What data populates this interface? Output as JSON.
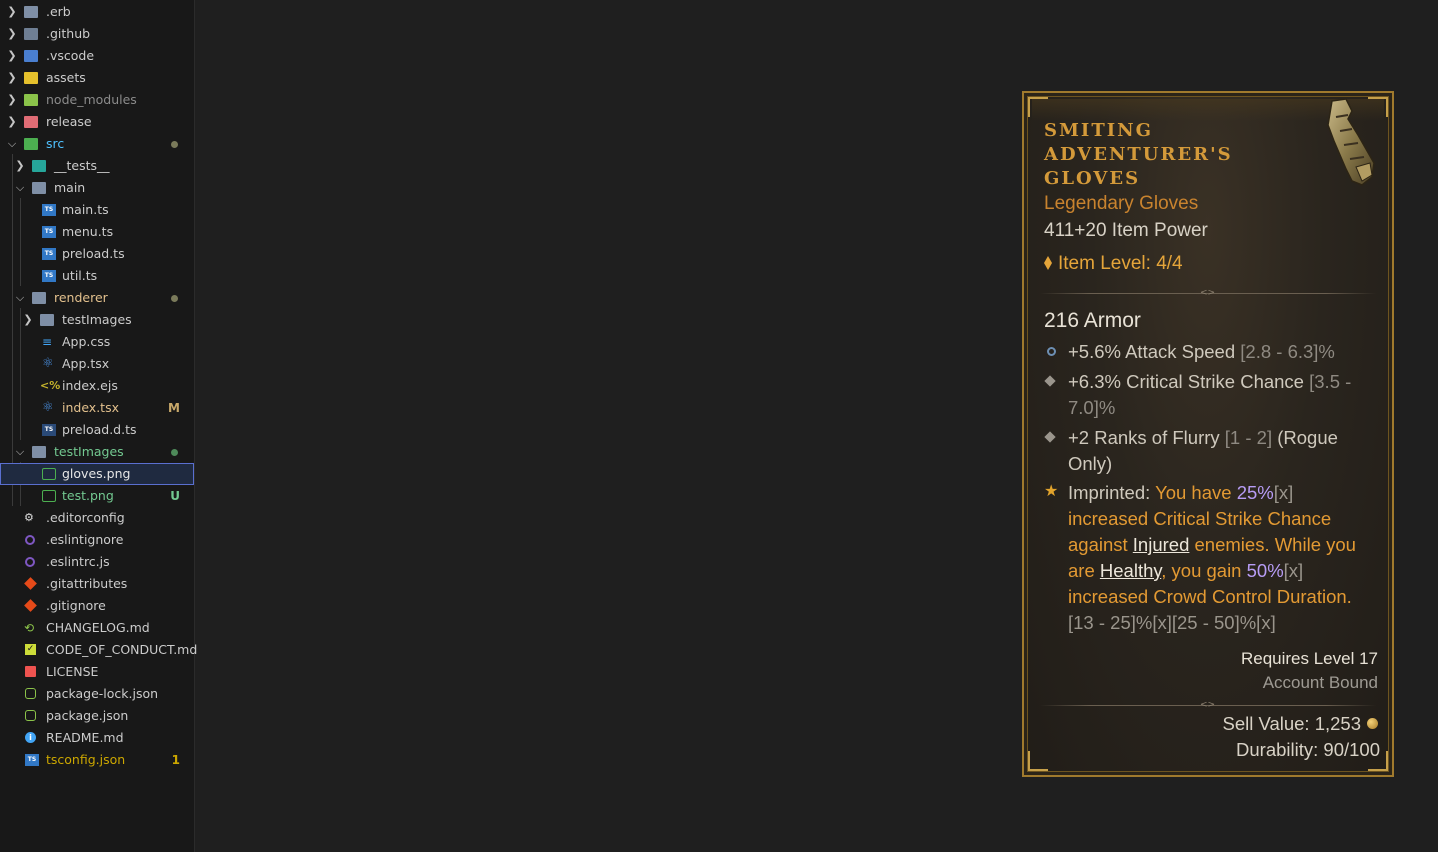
{
  "explorer": {
    "items": [
      {
        "label": ".erb"
      },
      {
        "label": ".github"
      },
      {
        "label": ".vscode"
      },
      {
        "label": "assets"
      },
      {
        "label": "node_modules"
      },
      {
        "label": "release"
      },
      {
        "label": "src"
      },
      {
        "label": "__tests__"
      },
      {
        "label": "main"
      },
      {
        "label": "main.ts"
      },
      {
        "label": "menu.ts"
      },
      {
        "label": "preload.ts"
      },
      {
        "label": "util.ts"
      },
      {
        "label": "renderer"
      },
      {
        "label": "testImages"
      },
      {
        "label": "App.css"
      },
      {
        "label": "App.tsx"
      },
      {
        "label": "index.ejs"
      },
      {
        "label": "index.tsx",
        "decoration": "M"
      },
      {
        "label": "preload.d.ts"
      },
      {
        "label": "testImages"
      },
      {
        "label": "gloves.png"
      },
      {
        "label": "test.png",
        "decoration": "U"
      },
      {
        "label": ".editorconfig"
      },
      {
        "label": ".eslintignore"
      },
      {
        "label": ".eslintrc.js"
      },
      {
        "label": ".gitattributes"
      },
      {
        "label": ".gitignore"
      },
      {
        "label": "CHANGELOG.md"
      },
      {
        "label": "CODE_OF_CONDUCT.md"
      },
      {
        "label": "LICENSE"
      },
      {
        "label": "package-lock.json"
      },
      {
        "label": "package.json"
      },
      {
        "label": "README.md"
      },
      {
        "label": "tsconfig.json",
        "decoration": "1"
      }
    ]
  },
  "tooltip": {
    "name_lines": [
      "Smiting",
      "Adventurer's",
      "Gloves"
    ],
    "rarity": "Legendary Gloves",
    "item_power": "411+20 Item Power",
    "item_level": "Item Level: 4/4",
    "armor": "216 Armor",
    "affixes": [
      {
        "text": "+5.6% Attack Speed ",
        "range": "[2.8 - 6.3]%"
      },
      {
        "text": "+6.3% Critical Strike Chance ",
        "range": "[3.5 - 7.0]%"
      },
      {
        "text": "+2 Ranks of Flurry ",
        "range": "[1 - 2]",
        "suffix": " (Rogue Only)"
      }
    ],
    "imprint": {
      "label": "Imprinted:",
      "p1": " You have ",
      "v1": "25%",
      "x1": "[x]",
      "p2": " increased Critical Strike Chance against ",
      "u1": "Injured",
      "p3": " enemies. While you are ",
      "u2": "Healthy",
      "p4": ", you gain ",
      "v2": "50%",
      "x2": "[x]",
      "p5": " increased Crowd Control Duration.",
      "ranges": "[13 - 25]%[x][25 - 50]%[x]"
    },
    "requires": "Requires Level 17",
    "bound": "Account Bound",
    "sell_value": "Sell Value: 1,253",
    "durability": "Durability: 90/100"
  }
}
